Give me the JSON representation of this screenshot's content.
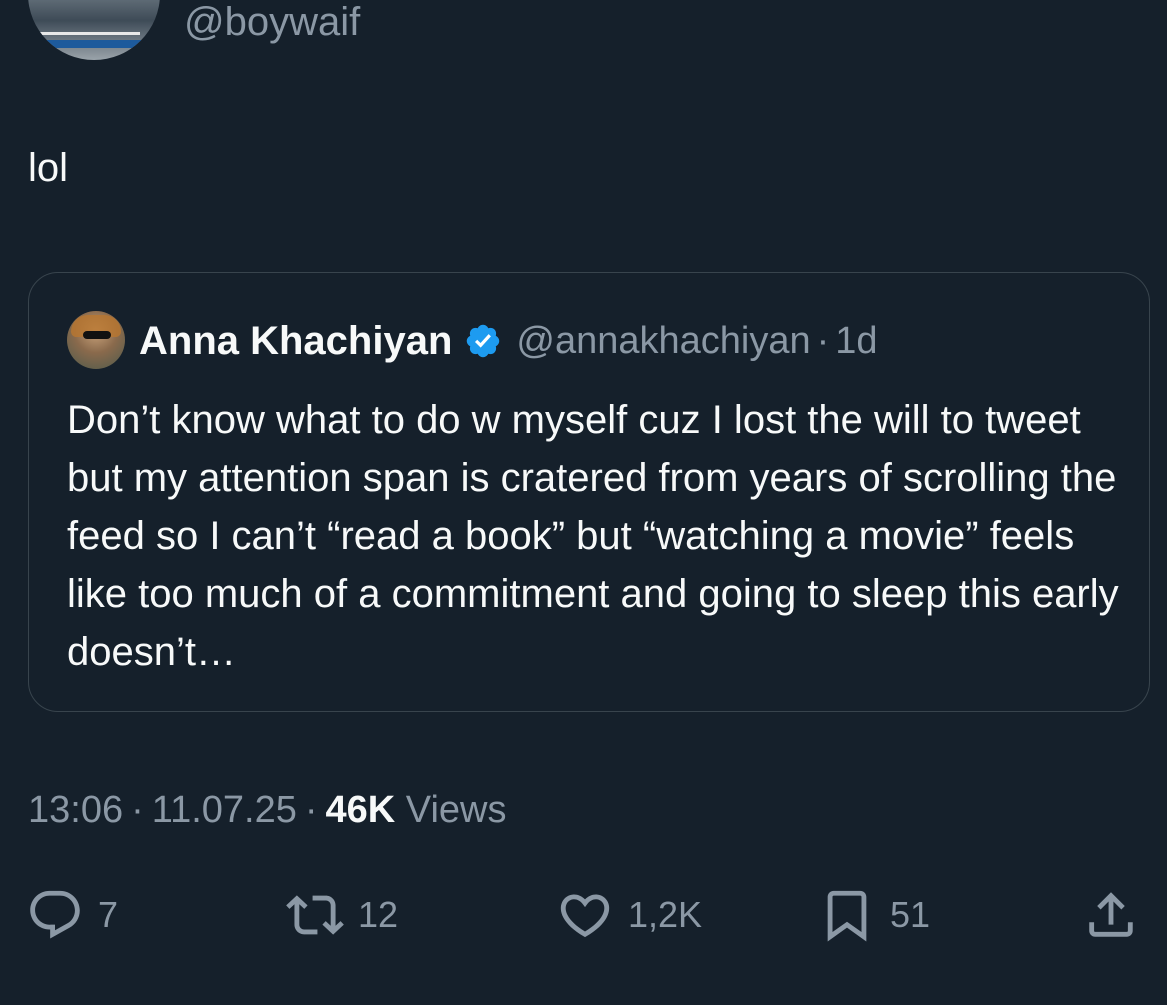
{
  "author": {
    "handle": "@boywaif"
  },
  "tweet": {
    "text": "lol"
  },
  "quote": {
    "name": "Anna Khachiyan",
    "handle": "@annakhachiyan",
    "dot": "·",
    "time": "1d",
    "body": "Don’t know what to do w myself cuz I lost the will to tweet but my attention span is cratered from years of scrolling the feed so I can’t “read a book” but “watching a movie” feels like too much of a commitment and going to sleep this early doesn’t…",
    "verified_color": "#1d9bf0"
  },
  "meta": {
    "time": "13:06",
    "sep1": "·",
    "date": "11.07.25",
    "sep2": "·",
    "views_count": "46K",
    "views_label": "Views"
  },
  "actions": {
    "reply_count": "7",
    "retweet_count": "12",
    "like_count": "1,2K",
    "bookmark_count": "51"
  },
  "colors": {
    "background": "#15202b",
    "primary_text": "#f7f9f9",
    "secondary_text": "#8b98a5",
    "border": "#38444d"
  }
}
